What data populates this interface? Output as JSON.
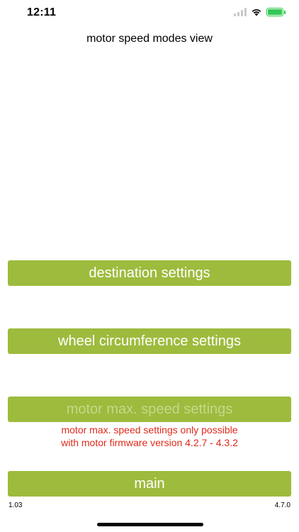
{
  "status_bar": {
    "time": "12:11",
    "icons": [
      "signal-icon",
      "wifi-icon",
      "battery-charging-icon"
    ],
    "battery_color": "#34c759"
  },
  "page": {
    "title": "motor speed modes view"
  },
  "buttons": {
    "destination_settings": "destination settings",
    "wheel_circumference_settings": "wheel circumference settings",
    "motor_max_speed_settings": "motor max. speed settings",
    "main": "main"
  },
  "warning": {
    "line1": "motor max. speed settings only possible",
    "line2": "with motor firmware version 4.2.7 - 4.3.2"
  },
  "footer": {
    "version_left": "1.03",
    "version_right": "4.7.0"
  },
  "colors": {
    "button_bg": "#9dbb3d",
    "button_text": "#ffffff",
    "disabled_text": "#c5d98a",
    "warning_text": "#e02a1a"
  }
}
